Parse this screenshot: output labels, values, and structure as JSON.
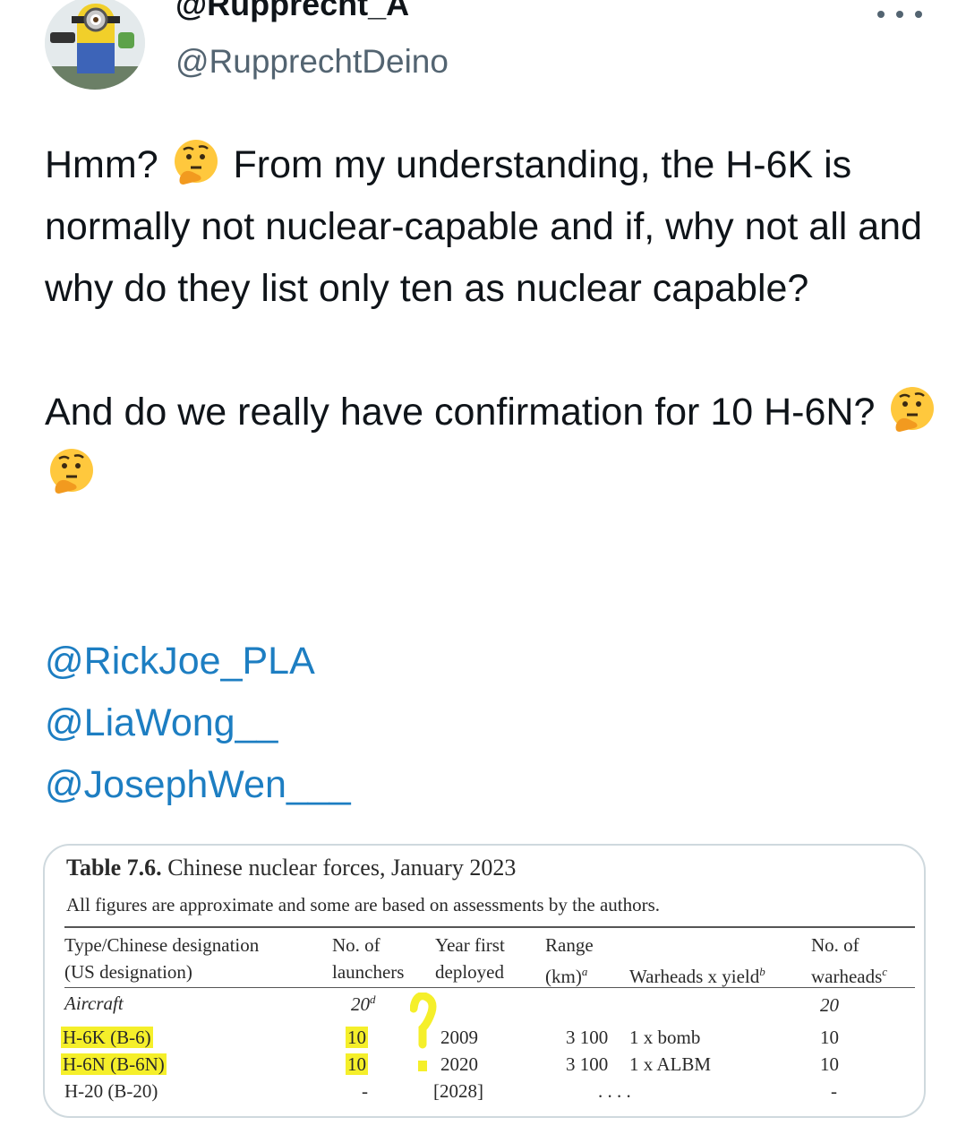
{
  "tweet": {
    "display_name": "@Rupprecht_A",
    "handle": "@RupprechtDeino",
    "text_1": "Hmm?",
    "text_2": "From my understanding, the H-6K is normally not nuclear-capable and if, why not all and why do they list only ten as nuclear capable?",
    "text_3": "And do we really have confirmation for 10 H-6N?",
    "emoji_icon": "thinking-face",
    "mentions": [
      "@RickJoe_PLA",
      "@LiaWong__",
      "@JosephWen___"
    ]
  },
  "table": {
    "title_bold": "Table 7.6.",
    "title_rest": "Chinese nuclear forces, January 2023",
    "subtitle": "All figures are approximate and some are based on assessments by the authors.",
    "headers": {
      "type_1": "Type/Chinese designation",
      "type_2": "(US designation)",
      "launchers_1": "No. of",
      "launchers_2": "launchers",
      "year_1": "Year first",
      "year_2": "deployed",
      "range_1": "Range",
      "range_2": "(km)",
      "range_sup": "a",
      "warheads_yield": "Warheads x yield",
      "yield_sup": "b",
      "num_1": "No. of",
      "num_2": "warheads",
      "num_sup": "c"
    },
    "section": {
      "label": "Aircraft",
      "launchers": "20",
      "launchers_sup": "d",
      "warheads": "20"
    },
    "rows": [
      {
        "type": "H-6K (B-6)",
        "launchers": "10",
        "year": "2009",
        "range": "3 100",
        "warheads_yield": "1 x bomb",
        "warheads": "10"
      },
      {
        "type": "H-6N (B-6N)",
        "launchers": "10",
        "year": "2020",
        "range": "3 100",
        "warheads_yield": "1 x ALBM",
        "warheads": "10"
      },
      {
        "type": "H-20 (B-20)",
        "launchers": "-",
        "year": "[2028]",
        "range": ". . . .",
        "warheads_yield": "",
        "warheads": "-"
      }
    ],
    "annotation_color": "#f5ef2a"
  },
  "colors": {
    "text": "#0f1419",
    "secondary": "#536471",
    "link": "#1d7ec2",
    "border": "#cfd9de"
  }
}
